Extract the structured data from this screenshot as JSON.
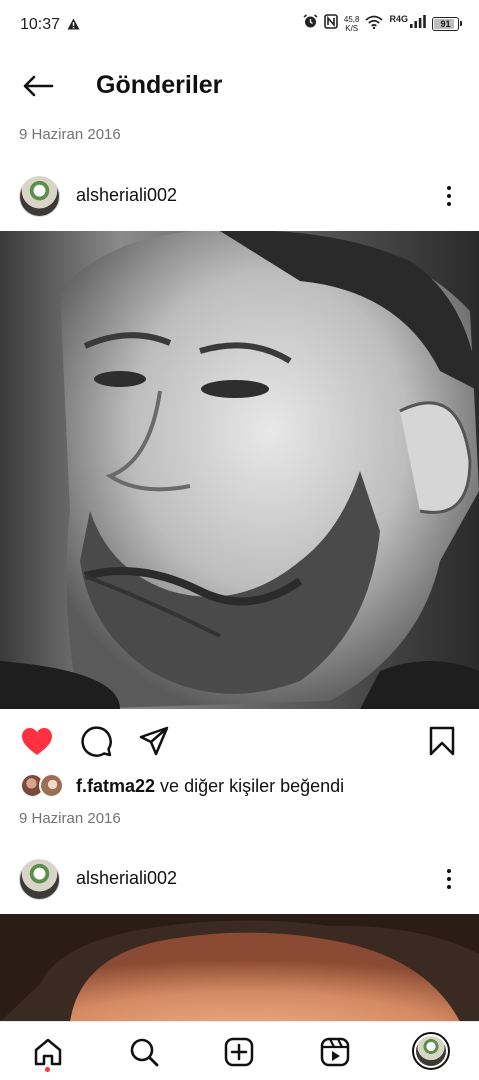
{
  "status_bar": {
    "time": "10:37",
    "net_speed_value": "45,8",
    "net_speed_unit": "K/S",
    "network_label": "R4G",
    "battery": "91"
  },
  "header": {
    "title": "Gönderiler"
  },
  "posts": [
    {
      "date_above": "9 Haziran 2016",
      "username": "alsheriali002",
      "photo": "black-and-white portrait",
      "liked": true,
      "liker": "f.fatma22",
      "likes_connector": "ve",
      "likes_suffix": "diğer kişiler beğendi",
      "date_below": "9 Haziran 2016"
    },
    {
      "username": "alsheriali002",
      "photo": "color portrait"
    }
  ],
  "icons": {
    "back": "arrow-left-icon",
    "more": "more-vertical-icon",
    "like": "heart-icon",
    "comment": "comment-icon",
    "share": "send-icon",
    "save": "bookmark-icon"
  },
  "bottom_nav": [
    "home",
    "search",
    "create",
    "reels",
    "profile"
  ],
  "colors": {
    "heart": "#ff3040",
    "secondary_text": "#737373",
    "notification_dot": "#ff3040"
  }
}
